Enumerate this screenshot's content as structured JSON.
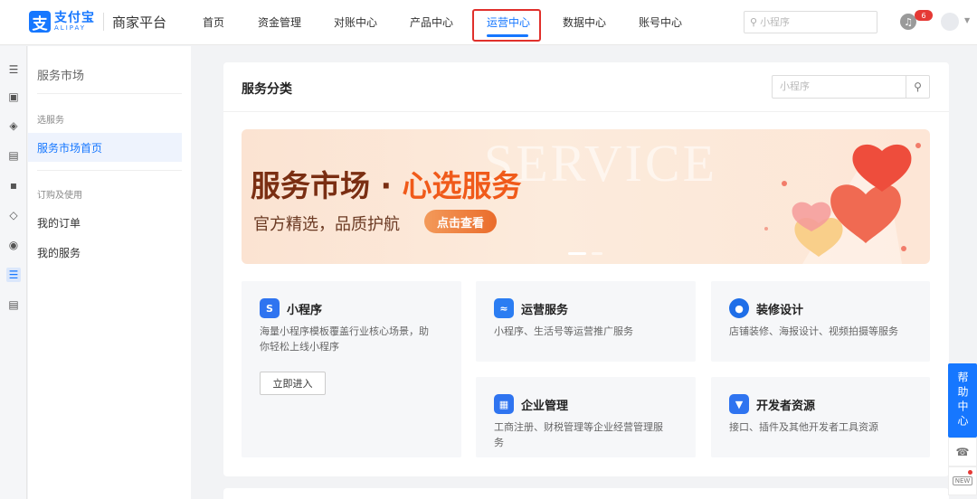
{
  "brand": {
    "logo_glyph": "支",
    "cn_name": "支付宝",
    "en_name": "ALIPAY",
    "platform": "商家平台"
  },
  "nav": {
    "items": [
      "首页",
      "资金管理",
      "对账中心",
      "产品中心",
      "运营中心",
      "数据中心",
      "账号中心"
    ],
    "active": "运营中心",
    "search_placeholder": "小程序",
    "search_icon": "search-icon",
    "notification_count": "6"
  },
  "rail": [
    "menu-icon",
    "dashboard-icon",
    "product-icon",
    "document-icon",
    "basket-icon",
    "package-icon",
    "settings-icon",
    "list-icon",
    "list-icon"
  ],
  "sidemenu": {
    "title": "服务市场",
    "groups": [
      {
        "label": "选服务",
        "items": [
          "服务市场首页"
        ]
      },
      {
        "label": "订购及使用",
        "items": [
          "我的订单",
          "我的服务"
        ]
      }
    ],
    "active": "服务市场首页"
  },
  "main": {
    "title": "服务分类",
    "search_placeholder": "小程序",
    "banner": {
      "watermark": "SERVICE",
      "headline_main": "服务市场 · ",
      "headline_highlight": "心选服务",
      "subline": "官方精选，品质护航",
      "cta": "点击查看"
    },
    "services": [
      {
        "name": "小程序",
        "desc_lines": [
          "海量小程序模板覆盖行业核心场景，助",
          "你轻松上线小程序"
        ],
        "button": "立即进入",
        "icon": "mini-program-icon",
        "color": "#2f74f0"
      },
      {
        "name": "运营服务",
        "desc_lines": [
          "小程序、生活号等运营推广服务"
        ],
        "icon": "chart-icon",
        "color": "#2b7df2"
      },
      {
        "name": "装修设计",
        "desc_lines": [
          "店铺装修、海报设计、视频拍摄等服务"
        ],
        "icon": "palette-icon",
        "color": "#1e6ee8"
      },
      {
        "name": "企业管理",
        "desc_lines": [
          "工商注册、财税管理等企业经营管理服",
          "务"
        ],
        "icon": "enterprise-icon",
        "color": "#2f74f0"
      },
      {
        "name": "开发者资源",
        "desc_lines": [
          "接口、插件及其他开发者工具资源"
        ],
        "icon": "developer-icon",
        "color": "#2f74f0"
      }
    ]
  },
  "help": {
    "label": "帮助中心",
    "tools": [
      "headset-icon",
      "new-icon"
    ],
    "new_label": "NEW"
  },
  "colors": {
    "primary": "#1677ff",
    "highlight_border": "#e0302b",
    "badge": "#e53935",
    "banner_accent": "#f05a1a"
  }
}
